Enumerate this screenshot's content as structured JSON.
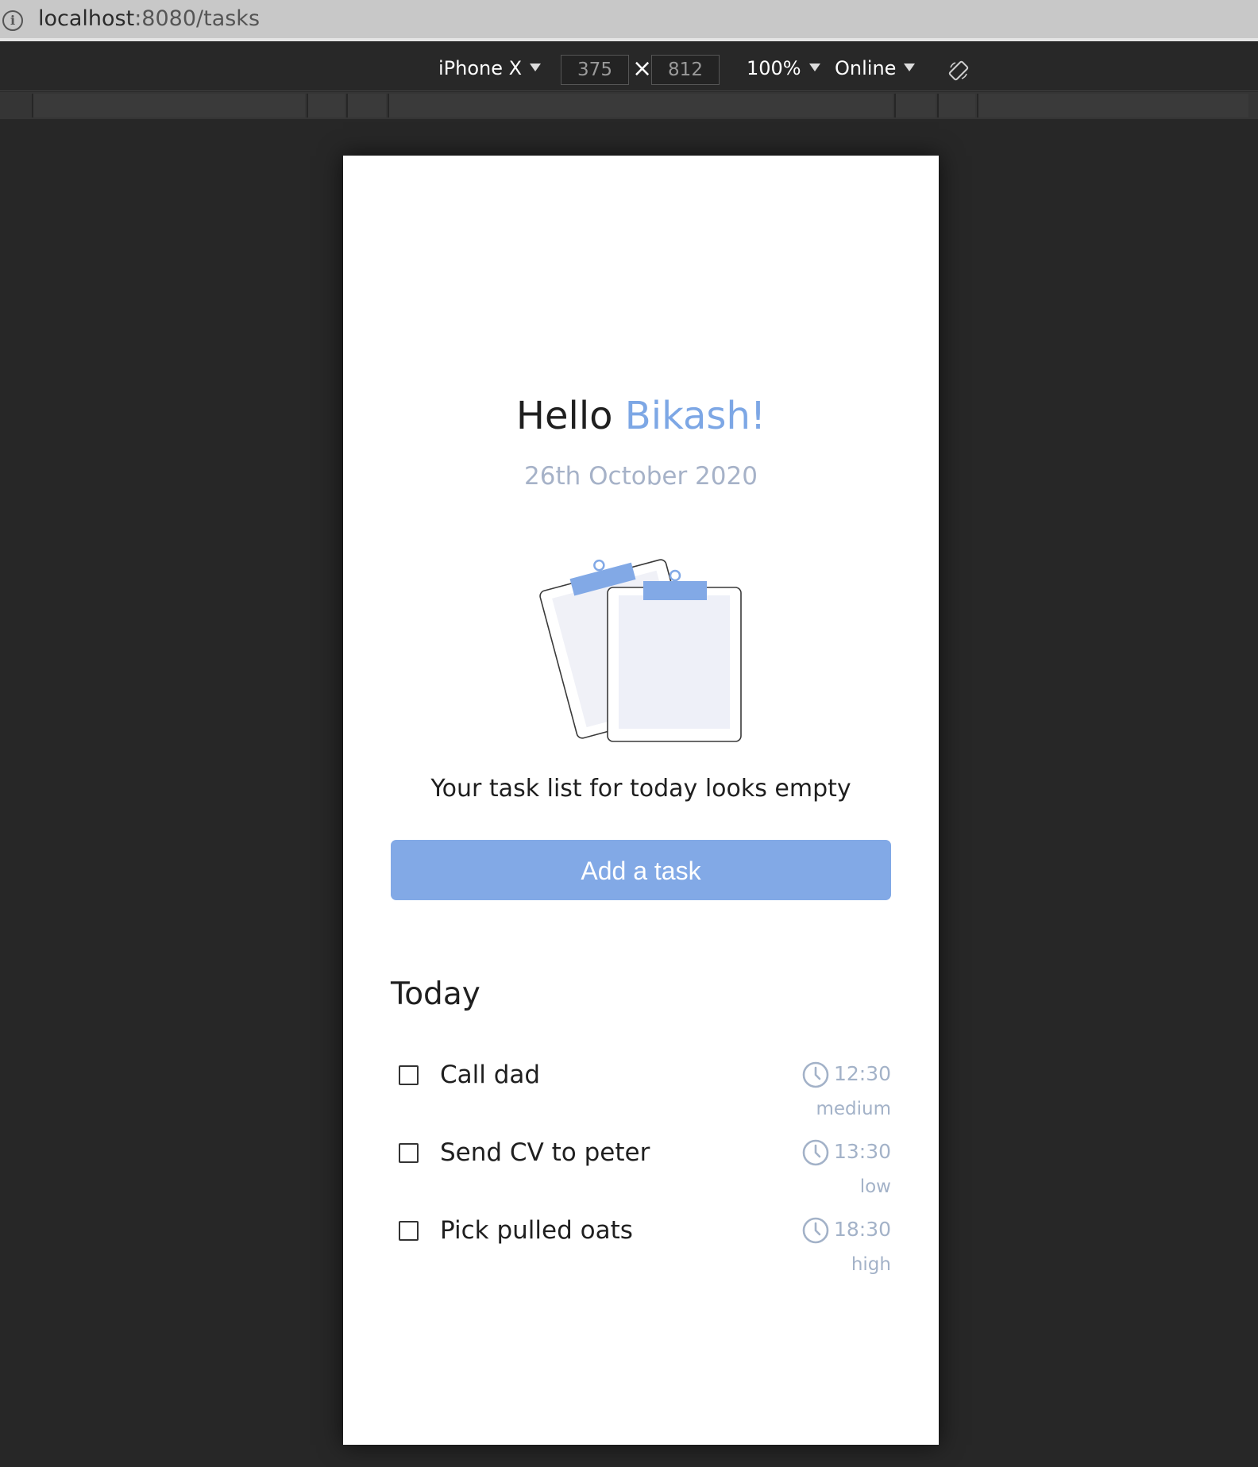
{
  "browser": {
    "url_host": "localhost",
    "url_path": ":8080/tasks"
  },
  "devtools": {
    "device": "iPhone X",
    "width": "375",
    "height": "812",
    "zoom": "100%",
    "network": "Online",
    "times_symbol": "×"
  },
  "app": {
    "greeting_prefix": "Hello ",
    "user_name": "Bikash!",
    "date": "26th October 2020",
    "empty_message": "Your task list for today looks empty",
    "add_button": "Add a task",
    "section_title": "Today",
    "tasks": [
      {
        "title": "Call dad",
        "time": "12:30",
        "priority": "medium"
      },
      {
        "title": "Send CV to peter",
        "time": "13:30",
        "priority": "low"
      },
      {
        "title": "Pick pulled oats",
        "time": "18:30",
        "priority": "high"
      }
    ]
  },
  "colors": {
    "accent": "#7da7e5",
    "button": "#82a9e6",
    "muted": "#a3b2c8",
    "devtools_bg": "#272727"
  }
}
